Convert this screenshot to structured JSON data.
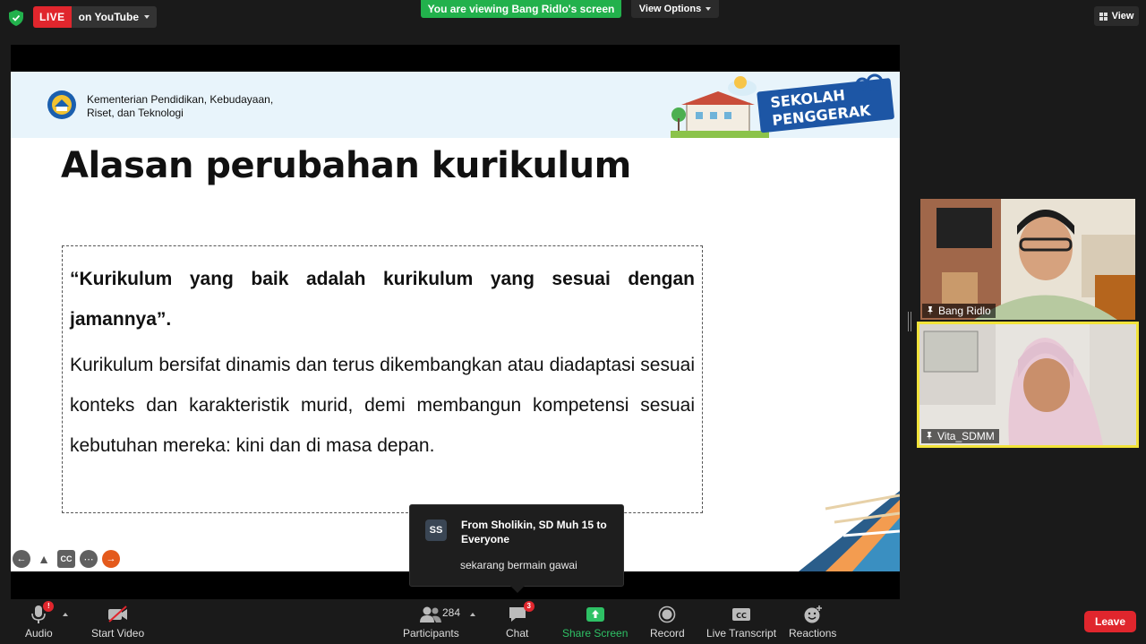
{
  "topbar": {
    "live_badge": "LIVE",
    "live_destination": "on YouTube",
    "viewing_banner": "You are viewing Bang Ridlo's screen",
    "view_options": "View Options",
    "view_button": "View"
  },
  "slide": {
    "ministry_line1": "Kementerian Pendidikan, Kebudayaan,",
    "ministry_line2": "Riset, dan Teknologi",
    "logo_text": "SEKOLAH PENGGERAK",
    "title": "Alasan perubahan kurikulum",
    "quote": "“Kurikulum yang baik adalah kurikulum yang sesuai dengan jamannya”.",
    "body": "Kurikulum bersifat dinamis dan terus dikembangkan atau diadaptasi sesuai konteks dan karakteristik murid, demi membangun kompetensi sesuai kebutuhan mereka: kini dan di masa depan."
  },
  "chat_toast": {
    "avatar_initials": "SS",
    "from": "From Sholikin, SD Muh 15 to Everyone",
    "message": "sekarang bermain gawai"
  },
  "participants": [
    {
      "name": "Bang Ridlo"
    },
    {
      "name": "Vita_SDMM"
    }
  ],
  "toolbar": {
    "audio": "Audio",
    "audio_badge": "!",
    "start_video": "Start Video",
    "participants": "Participants",
    "participant_count": "284",
    "chat": "Chat",
    "chat_badge": "3",
    "share_screen": "Share Screen",
    "record": "Record",
    "live_transcript": "Live Transcript",
    "reactions": "Reactions",
    "leave": "Leave"
  },
  "colors": {
    "live_red": "#e0262d",
    "share_green": "#22b14c",
    "active_speaker": "#f2e33a"
  }
}
